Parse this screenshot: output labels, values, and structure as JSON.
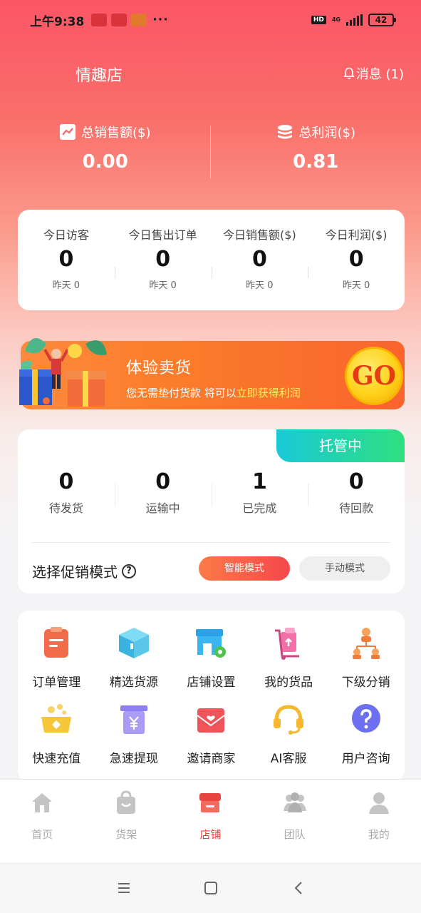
{
  "status_bar": {
    "time": "上午9:38",
    "dots": "···",
    "hd": "HD",
    "network": "4G",
    "battery": "42"
  },
  "header": {
    "shop_name": "情趣店",
    "messages_label": "消息 (1)"
  },
  "totals": {
    "sales_label": "总销售额($)",
    "sales_value": "0.00",
    "profit_label": "总利润($)",
    "profit_value": "0.81"
  },
  "today": [
    {
      "label": "今日访客",
      "value": "0",
      "yesterday": "昨天 0"
    },
    {
      "label": "今日售出订单",
      "value": "0",
      "yesterday": "昨天 0"
    },
    {
      "label": "今日销售额($)",
      "value": "0",
      "yesterday": "昨天 0"
    },
    {
      "label": "今日利润($)",
      "value": "0",
      "yesterday": "昨天 0"
    }
  ],
  "banner": {
    "title": "体验卖货",
    "subtitle_prefix": "您无需垫付货款 将可以",
    "subtitle_highlight": "立即获得利润",
    "go_label": "GO"
  },
  "orders": {
    "hosting_tag": "托管中",
    "stats": [
      {
        "value": "0",
        "label": "待发货"
      },
      {
        "value": "0",
        "label": "运输中"
      },
      {
        "value": "1",
        "label": "已完成"
      },
      {
        "value": "0",
        "label": "待回款"
      }
    ],
    "promo_label": "选择促销模式",
    "help_glyph": "?",
    "mode_smart": "智能模式",
    "mode_manual": "手动模式"
  },
  "menu": [
    {
      "label": "订单管理",
      "icon": "order-icon"
    },
    {
      "label": "精选货源",
      "icon": "box-icon"
    },
    {
      "label": "店铺设置",
      "icon": "shop-settings-icon"
    },
    {
      "label": "我的货品",
      "icon": "goods-icon"
    },
    {
      "label": "下级分销",
      "icon": "distribution-icon"
    },
    {
      "label": "快速充值",
      "icon": "recharge-icon"
    },
    {
      "label": "急速提现",
      "icon": "withdraw-icon"
    },
    {
      "label": "邀请商家",
      "icon": "invite-icon"
    },
    {
      "label": "AI客服",
      "icon": "headset-icon"
    },
    {
      "label": "用户咨询",
      "icon": "question-icon"
    }
  ],
  "tabs": [
    {
      "label": "首页",
      "icon": "home-icon",
      "active": false
    },
    {
      "label": "货架",
      "icon": "bag-icon",
      "active": false
    },
    {
      "label": "店铺",
      "icon": "store-icon",
      "active": true
    },
    {
      "label": "团队",
      "icon": "team-icon",
      "active": false
    },
    {
      "label": "我的",
      "icon": "profile-icon",
      "active": false
    }
  ],
  "colors": {
    "brand_red": "#e8443f",
    "header_gradient_top": "#fb5566",
    "hosting_gradient": "#19c9d8",
    "banner_orange": "#fb7c2b"
  }
}
